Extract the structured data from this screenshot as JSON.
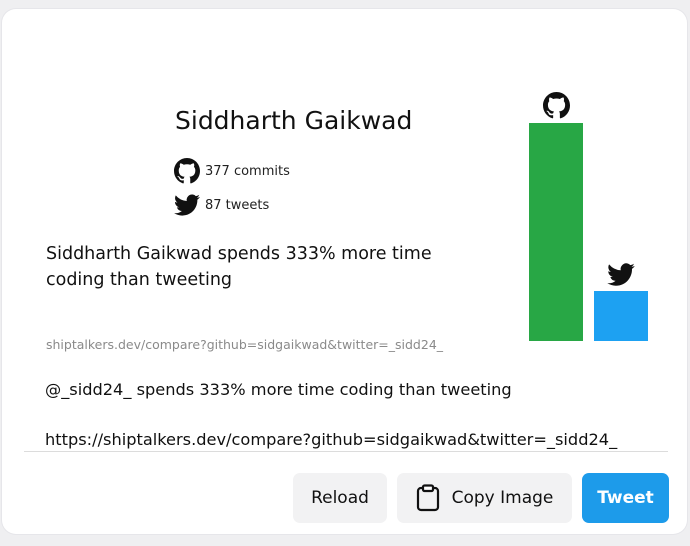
{
  "profile": {
    "name": "Siddharth Gaikwad",
    "commits": "377 commits",
    "tweets": "87 tweets"
  },
  "statement": "Siddharth Gaikwad spends 333% more time coding than tweeting",
  "share_url": "shiptalkers.dev/compare?github=sidgaikwad&twitter=_sidd24_",
  "tweet": {
    "line1": "@_sidd24_ spends 333% more time coding than tweeting",
    "line2": "https://shiptalkers.dev/compare?github=sidgaikwad&twitter=_sidd24_"
  },
  "buttons": {
    "reload": "Reload",
    "copy_image": "Copy Image",
    "tweet": "Tweet"
  },
  "icons": {
    "github": "github-icon",
    "twitter": "twitter-icon",
    "clipboard": "clipboard-icon"
  },
  "chart_data": {
    "type": "bar",
    "categories": [
      "GitHub",
      "Twitter"
    ],
    "values": [
      377,
      87
    ],
    "colors": [
      "#28a745",
      "#1da1f2"
    ]
  }
}
